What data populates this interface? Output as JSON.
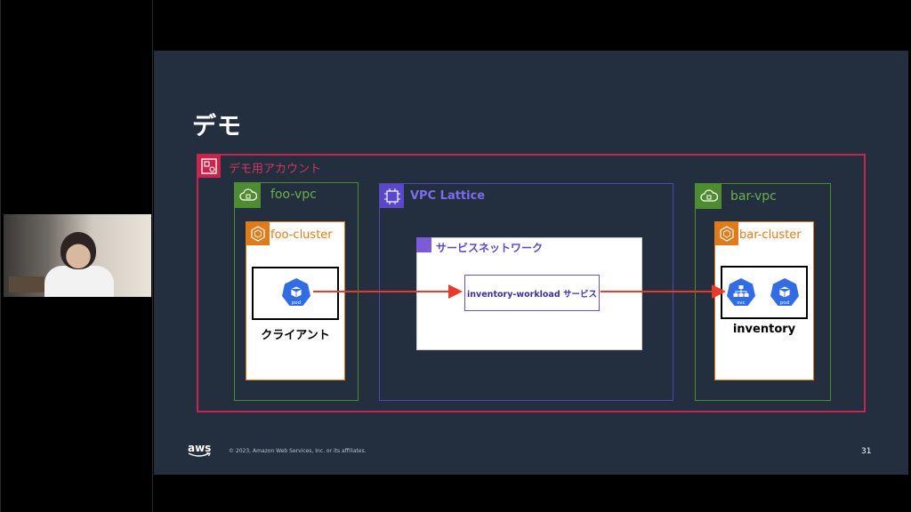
{
  "slide": {
    "title": "デモ",
    "page_number": "31",
    "footer_copyright": "© 2023, Amazon Web Services, Inc. or its affiliates.",
    "footer_logo": "aws"
  },
  "diagram": {
    "account": {
      "label": "デモ用アカウント",
      "color": "#c7254e"
    },
    "foo_vpc": {
      "label": "foo-vpc",
      "color": "#4d8c2f"
    },
    "bar_vpc": {
      "label": "bar-vpc",
      "color": "#4d8c2f"
    },
    "lattice": {
      "label": "VPC Lattice",
      "color": "#5a48c8"
    },
    "foo_cluster": {
      "label": "foo-cluster",
      "color": "#e07b1a"
    },
    "bar_cluster": {
      "label": "bar-cluster",
      "color": "#e07b1a"
    },
    "client": {
      "label": "クライアント",
      "pod_label": "pod"
    },
    "inventory": {
      "label": "inventory",
      "svc_label": "svc",
      "pod_label": "pod"
    },
    "service_network": {
      "label": "サービスネットワーク"
    },
    "service": {
      "label": "inventory-workload サービス"
    },
    "arrow_color": "#e8392b"
  }
}
